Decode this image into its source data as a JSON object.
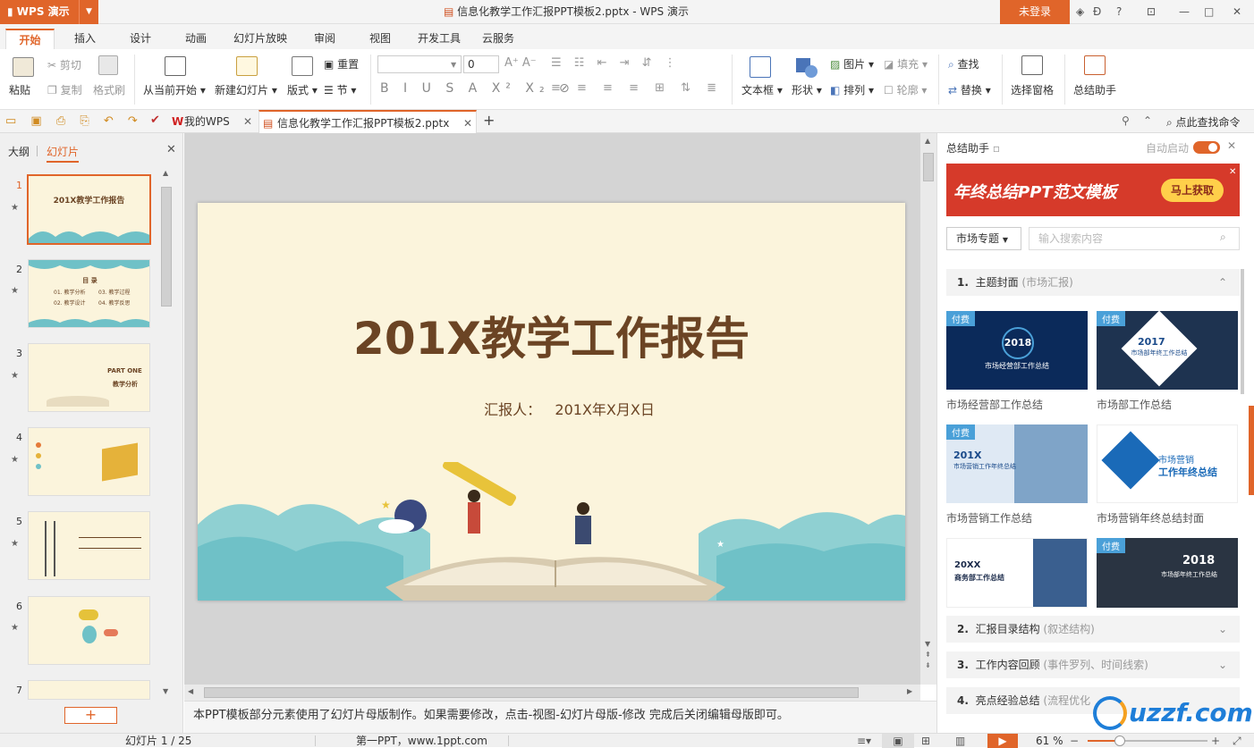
{
  "app": {
    "name": "WPS 演示",
    "title": "信息化教学工作汇报PPT模板2.pptx - WPS 演示",
    "login": "未登录"
  },
  "ribbon_tabs": [
    "开始",
    "插入",
    "设计",
    "动画",
    "幻灯片放映",
    "审阅",
    "视图",
    "开发工具",
    "云服务"
  ],
  "ribbon": {
    "paste": "粘贴",
    "cut": "剪切",
    "copy": "复制",
    "format_painter": "格式刷",
    "from_current": "从当前开始",
    "new_slide": "新建幻灯片",
    "layout": "版式",
    "reset": "重置",
    "section": "节",
    "font_size": "0",
    "textbox": "文本框",
    "shape": "形状",
    "picture": "图片",
    "fill": "填充",
    "arrange": "排列",
    "outline": "轮廓",
    "find": "查找",
    "replace": "替换",
    "selection_pane": "选择窗格",
    "summary_assistant": "总结助手"
  },
  "doc_tabs": [
    "我的WPS",
    "信息化教学工作汇报PPT模板2.pptx"
  ],
  "search_cmd": "点此查找命令",
  "left_panel": {
    "tab_outline": "大纲",
    "tab_slides": "幻灯片",
    "slides": [
      {
        "num": "1",
        "text": "201X教学工作报告"
      },
      {
        "num": "2",
        "text": "目 录",
        "items": [
          "01. 教学分析",
          "03. 教学过程",
          "02. 教学设计",
          "04. 教学反思"
        ]
      },
      {
        "num": "3",
        "text": "PART ONE",
        "sub": "教学分析"
      },
      {
        "num": "4",
        "text": ""
      },
      {
        "num": "5",
        "text": ""
      },
      {
        "num": "6",
        "text": ""
      },
      {
        "num": "7",
        "text": ""
      }
    ]
  },
  "slide": {
    "title": "201X教学工作报告",
    "reporter": "汇报人：",
    "date": "201X年X月X日"
  },
  "notes": "本PPT模板部分元素使用了幻灯片母版制作。如果需要修改，点击-视图-幻灯片母版-修改 完成后关闭编辑母版即可。",
  "right_panel": {
    "title": "总结助手",
    "auto_start": "自动启动",
    "banner": "年终总结PPT范文模板",
    "banner_btn": "马上获取",
    "category": "市场专题",
    "search_placeholder": "输入搜索内容",
    "section1": {
      "num": "1.",
      "label": "主题封面",
      "hint": "(市场汇报)"
    },
    "templates": [
      {
        "paid": "付费",
        "caption": "市场经营部工作总结",
        "thumb_text": "2018",
        "thumb_sub": "市场经营部工作总结"
      },
      {
        "paid": "付费",
        "caption": "市场部工作总结",
        "thumb_text": "2017",
        "thumb_sub": "市场部年终工作总结"
      },
      {
        "paid": "付费",
        "caption": "市场营销工作总结",
        "thumb_text": "201X",
        "thumb_sub": "市场营销工作年终总结"
      },
      {
        "paid": "",
        "caption": "市场营销年终总结封面",
        "thumb_text": "市场营销",
        "thumb_sub": "工作年终总结"
      },
      {
        "paid": "",
        "caption": "",
        "thumb_text": "20XX",
        "thumb_sub": "商务部工作总结"
      },
      {
        "paid": "付费",
        "caption": "",
        "thumb_text": "2018",
        "thumb_sub": "市场部年终工作总结"
      }
    ],
    "section2": {
      "num": "2.",
      "label": "汇报目录结构",
      "hint": "(叙述结构)"
    },
    "section3": {
      "num": "3.",
      "label": "工作内容回顾",
      "hint": "(事件罗列、时间线索)"
    },
    "section4": {
      "num": "4.",
      "label": "亮点经验总结",
      "hint": "(流程优化"
    }
  },
  "status": {
    "slide_count": "幻灯片 1 / 25",
    "theme": "第一PPT，www.1ppt.com",
    "zoom": "61 %"
  },
  "watermark": "uzzf.com"
}
